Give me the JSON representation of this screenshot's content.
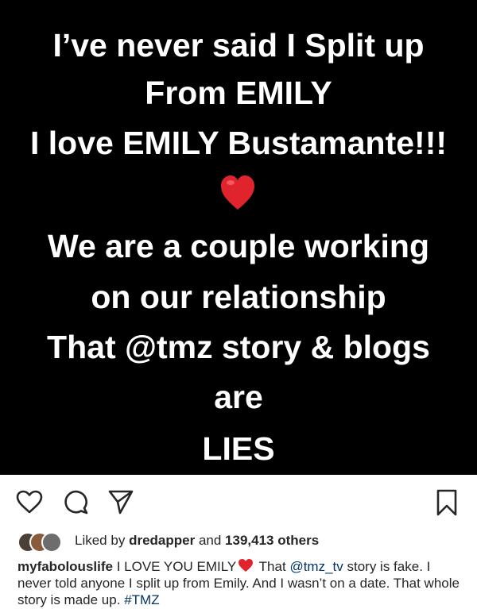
{
  "post_image": {
    "lines": [
      "I’ve never said I Split up",
      "From EMILY",
      "I love EMILY Bustamante!!!",
      "We are a couple working",
      "on our relationship",
      "That @tmz story & blogs",
      "are",
      "LIES"
    ],
    "heart_icon": "red-heart-emoji"
  },
  "actions": {
    "like_icon": "heart-outline-icon",
    "comment_icon": "comment-bubble-icon",
    "share_icon": "paper-plane-icon",
    "save_icon": "bookmark-icon"
  },
  "likes": {
    "prefix": "Liked by",
    "user": "dredapper",
    "connector": "and",
    "others": "139,413 others"
  },
  "caption": {
    "username": "myfabolouslife",
    "text_part1": "I LOVE YOU EMILY",
    "text_part2": "That",
    "mention": "@tmz_tv",
    "text_part3": "story is fake. I never told anyone I split up from Emily. And I wasn’t on a date. That whole story is made up.",
    "hashtag": "#TMZ"
  },
  "colors": {
    "background": "#ffffff",
    "image_background": "#000000",
    "link": "#003569",
    "heart": "#e0242e"
  }
}
